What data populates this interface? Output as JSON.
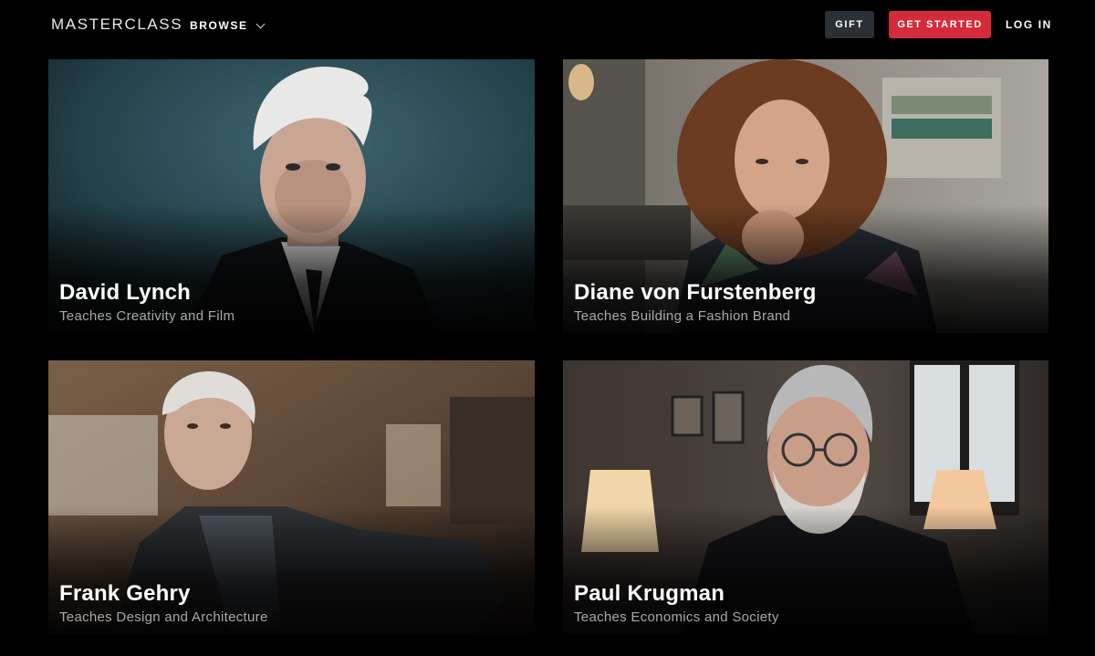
{
  "header": {
    "logo": "MASTERCLASS",
    "browse_label": "BROWSE",
    "gift_label": "GIFT",
    "get_started_label": "GET STARTED",
    "login_label": "LOG IN"
  },
  "colors": {
    "background": "#000000",
    "gift_button": "#2b2f36",
    "get_started_button": "#d42b3a",
    "subtitle_text": "#a9a9a9"
  },
  "instructors": [
    {
      "name": "David Lynch",
      "subject": "Teaches Creativity and Film"
    },
    {
      "name": "Diane von Furstenberg",
      "subject": "Teaches Building a Fashion Brand"
    },
    {
      "name": "Frank Gehry",
      "subject": "Teaches Design and Architecture"
    },
    {
      "name": "Paul Krugman",
      "subject": "Teaches Economics and Society"
    }
  ]
}
